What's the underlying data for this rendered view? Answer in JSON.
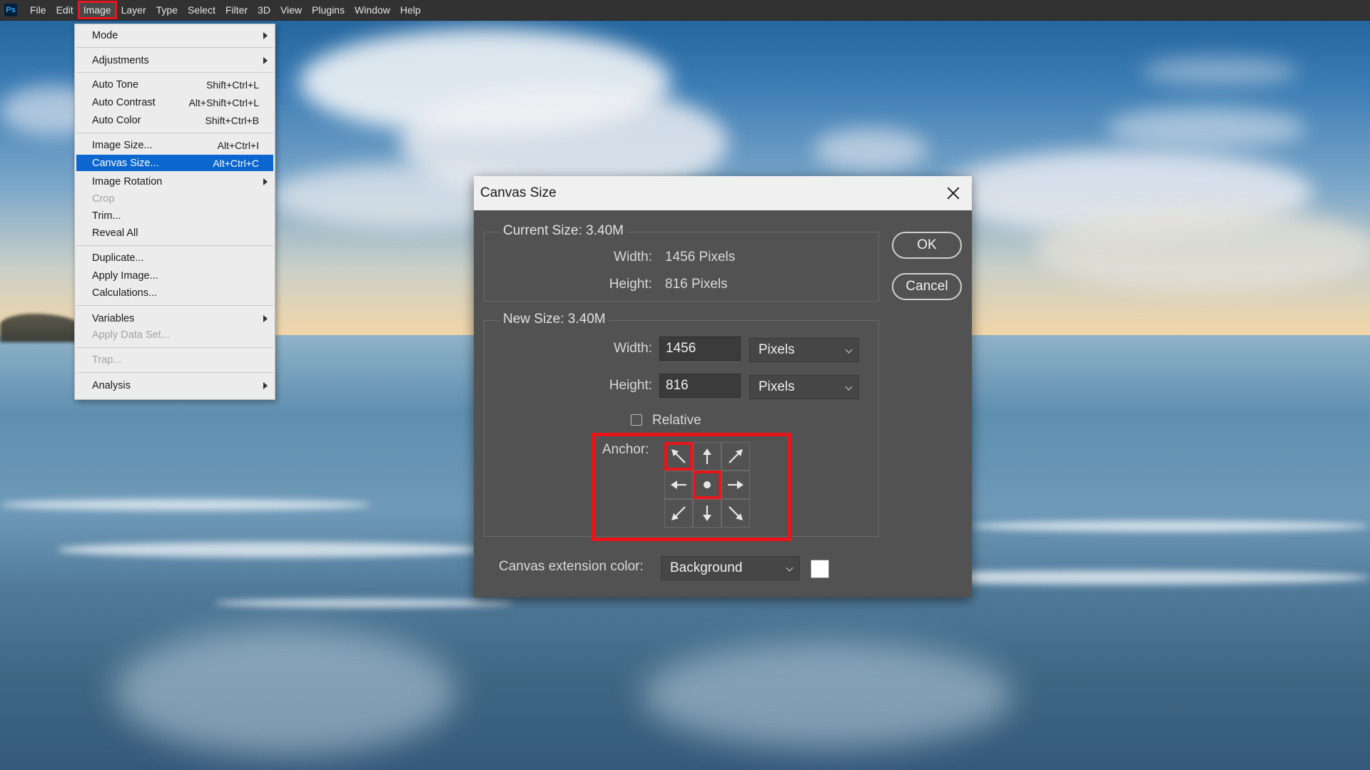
{
  "app": {
    "logo": "Ps"
  },
  "menubar": {
    "items": [
      "File",
      "Edit",
      "Image",
      "Layer",
      "Type",
      "Select",
      "Filter",
      "3D",
      "View",
      "Plugins",
      "Window",
      "Help"
    ],
    "active": "Image"
  },
  "image_menu": {
    "items": [
      {
        "label": "Mode",
        "shortcut": "",
        "submenu": true,
        "disabled": false
      },
      {
        "label": "Adjustments",
        "shortcut": "",
        "submenu": true,
        "disabled": false
      },
      {
        "label": "Auto Tone",
        "shortcut": "Shift+Ctrl+L",
        "submenu": false,
        "disabled": false
      },
      {
        "label": "Auto Contrast",
        "shortcut": "Alt+Shift+Ctrl+L",
        "submenu": false,
        "disabled": false
      },
      {
        "label": "Auto Color",
        "shortcut": "Shift+Ctrl+B",
        "submenu": false,
        "disabled": false
      },
      {
        "label": "Image Size...",
        "shortcut": "Alt+Ctrl+I",
        "submenu": false,
        "disabled": false
      },
      {
        "label": "Canvas Size...",
        "shortcut": "Alt+Ctrl+C",
        "submenu": false,
        "disabled": false,
        "highlighted": true
      },
      {
        "label": "Image Rotation",
        "shortcut": "",
        "submenu": true,
        "disabled": false
      },
      {
        "label": "Crop",
        "shortcut": "",
        "submenu": false,
        "disabled": true
      },
      {
        "label": "Trim...",
        "shortcut": "",
        "submenu": false,
        "disabled": false
      },
      {
        "label": "Reveal All",
        "shortcut": "",
        "submenu": false,
        "disabled": false
      },
      {
        "label": "Duplicate...",
        "shortcut": "",
        "submenu": false,
        "disabled": false
      },
      {
        "label": "Apply Image...",
        "shortcut": "",
        "submenu": false,
        "disabled": false
      },
      {
        "label": "Calculations...",
        "shortcut": "",
        "submenu": false,
        "disabled": false
      },
      {
        "label": "Variables",
        "shortcut": "",
        "submenu": true,
        "disabled": false
      },
      {
        "label": "Apply Data Set...",
        "shortcut": "",
        "submenu": false,
        "disabled": true
      },
      {
        "label": "Trap...",
        "shortcut": "",
        "submenu": false,
        "disabled": true
      },
      {
        "label": "Analysis",
        "shortcut": "",
        "submenu": true,
        "disabled": false
      }
    ]
  },
  "dialog": {
    "title": "Canvas Size",
    "current": {
      "title": "Current Size: 3.40M",
      "width_label": "Width:",
      "width_value": "1456 Pixels",
      "height_label": "Height:",
      "height_value": "816 Pixels"
    },
    "new": {
      "title": "New Size: 3.40M",
      "width_label": "Width:",
      "width_value": "1456",
      "width_unit": "Pixels",
      "height_label": "Height:",
      "height_value": "816",
      "height_unit": "Pixels",
      "relative_label": "Relative",
      "relative_checked": false,
      "anchor_label": "Anchor:",
      "anchor_selected": "center"
    },
    "extension_label": "Canvas extension color:",
    "extension_value": "Background",
    "extension_swatch_color": "#ffffff",
    "ok_label": "OK",
    "cancel_label": "Cancel"
  },
  "colors": {
    "highlight_red": "#e8151b",
    "menu_selection": "#0b66d0",
    "dialog_bg": "#525252"
  }
}
